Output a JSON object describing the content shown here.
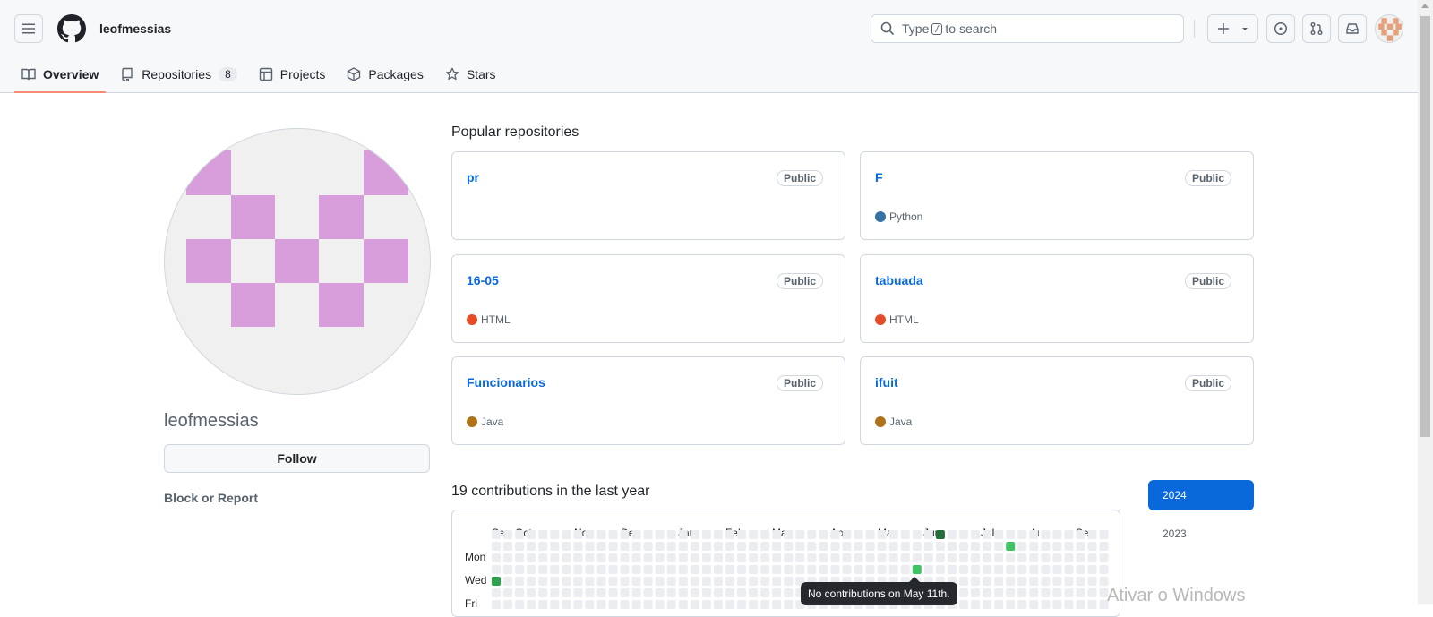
{
  "header": {
    "username": "leofmessias",
    "search_before": "Type",
    "search_key": "/",
    "search_after": "to search",
    "icons": [
      "hamburger-icon",
      "github-logo-icon",
      "search-icon",
      "plus-icon",
      "chevron-down-icon",
      "issues-icon",
      "pull-requests-icon",
      "inbox-icon"
    ]
  },
  "nav": {
    "tabs": [
      {
        "label": "Overview",
        "icon": "book-icon",
        "active": true
      },
      {
        "label": "Repositories",
        "icon": "repo-icon",
        "count": "8"
      },
      {
        "label": "Projects",
        "icon": "table-icon"
      },
      {
        "label": "Packages",
        "icon": "package-icon"
      },
      {
        "label": "Stars",
        "icon": "star-icon"
      }
    ]
  },
  "profile": {
    "username": "leofmessias",
    "follow_label": "Follow",
    "block_label": "Block or Report",
    "avatar_color": "#d89ddb"
  },
  "popular": {
    "title": "Popular repositories",
    "repos": [
      {
        "name": "pr",
        "badge": "Public",
        "language": "",
        "lang_color": ""
      },
      {
        "name": "F",
        "badge": "Public",
        "language": "Python",
        "lang_color": "#3572A5"
      },
      {
        "name": "16-05",
        "badge": "Public",
        "language": "HTML",
        "lang_color": "#e34c26"
      },
      {
        "name": "tabuada",
        "badge": "Public",
        "language": "HTML",
        "lang_color": "#e34c26"
      },
      {
        "name": "Funcionarios",
        "badge": "Public",
        "language": "Java",
        "lang_color": "#b07219"
      },
      {
        "name": "ifuit",
        "badge": "Public",
        "language": "Java",
        "lang_color": "#b07219"
      }
    ]
  },
  "contributions": {
    "title": "19 contributions in the last year",
    "months": [
      "Sep",
      "Oct",
      "Nov",
      "Dec",
      "Jan",
      "Feb",
      "Mar",
      "Apr",
      "May",
      "Jun",
      "Jul",
      "Aug",
      "Sep"
    ],
    "days": [
      "Mon",
      "Wed",
      "Fri"
    ],
    "tooltip": "No contributions on May 11th.",
    "years": [
      "2024",
      "2023"
    ],
    "selected_year": "2024"
  },
  "watermark": "Ativar o Windows",
  "colors": {
    "accent": "#0969da",
    "underline": "#fd8c73",
    "grid_empty": "#ebedf0",
    "grid_dark": "#216e39",
    "grid_mid": "#40c463",
    "grid_med": "#30a14e"
  }
}
